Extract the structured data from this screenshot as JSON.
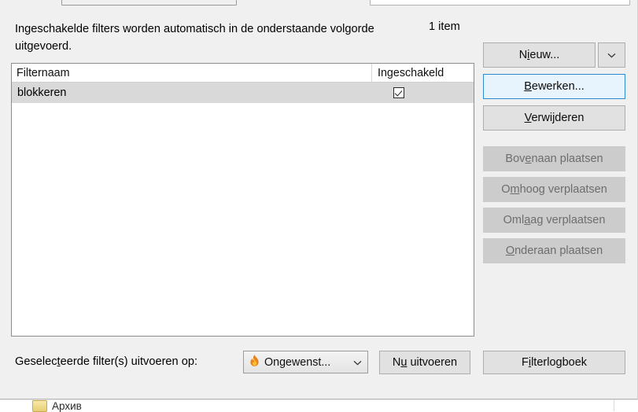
{
  "background": {
    "folder_label": "Архив"
  },
  "dialog": {
    "intro_text": "Ingeschakelde filters worden automatisch in de onderstaande volgorde uitgevoerd.",
    "item_count": "1 item",
    "list": {
      "columns": [
        {
          "label": "Filternaam",
          "name": "filter-name"
        },
        {
          "label": "Ingeschakeld",
          "name": "enabled"
        }
      ],
      "rows": [
        {
          "name": "blokkeren",
          "enabled": true,
          "selected": true
        }
      ]
    },
    "buttons": {
      "nieuw": {
        "before": "N",
        "accel": "i",
        "after": "euw..."
      },
      "nieuw_full": "Nieuw...",
      "nieuw_dropdown_icon": "chevron-down-icon",
      "bewerken": {
        "before": "",
        "accel": "B",
        "after": "ewerken..."
      },
      "bewerken_full": "Bewerken...",
      "verwijderen": {
        "before": "",
        "accel": "V",
        "after": "erwijderen"
      },
      "verwijderen_full": "Verwijderen",
      "bovenaan": {
        "before": "Bov",
        "accel": "e",
        "after": "naan plaatsen"
      },
      "bovenaan_full": "Bovenaan plaatsen",
      "omhoog": {
        "before": "O",
        "accel": "m",
        "after": "hoog verplaatsen"
      },
      "omhoog_full": "Omhoog verplaatsen",
      "omlaag": {
        "before": "Oml",
        "accel": "a",
        "after": "ag verplaatsen"
      },
      "omlaag_full": "Omlaag verplaatsen",
      "onderaan": {
        "before": "",
        "accel": "O",
        "after": "nderaan plaatsen"
      },
      "onderaan_full": "Onderaan plaatsen",
      "nu_uitvoeren": {
        "before": "N",
        "accel": "u",
        "after": " uitvoeren"
      },
      "nu_uitvoeren_full": "Nu uitvoeren",
      "filterlogboek": {
        "before": "F",
        "accel": "i",
        "after": "lterlogboek"
      },
      "filterlogboek_full": "Filterlogboek"
    },
    "bottom_bar": {
      "run_label": {
        "before": "Geselec",
        "accel": "t",
        "after": "eerde filter(s) uitvoeren op:"
      },
      "run_label_full": "Geselecteerde filter(s) uitvoeren op:",
      "target_select": {
        "value": "Ongewenst...",
        "icon": "flame-icon",
        "arrow_icon": "chevron-down-icon"
      }
    }
  },
  "colors": {
    "dialog_background": "#f0f0f0",
    "button_face": "#e1e1e1",
    "button_border": "#adadad",
    "button_disabled_face": "#cccccc",
    "button_disabled_text": "#6d6d6d",
    "focus_border": "#2a8ad4",
    "focus_fill": "#e8f4fd",
    "list_background": "#ffffff",
    "row_selected": "#d9d9d9",
    "flame_outer": "#e8821a",
    "flame_inner": "#fbc02d"
  }
}
